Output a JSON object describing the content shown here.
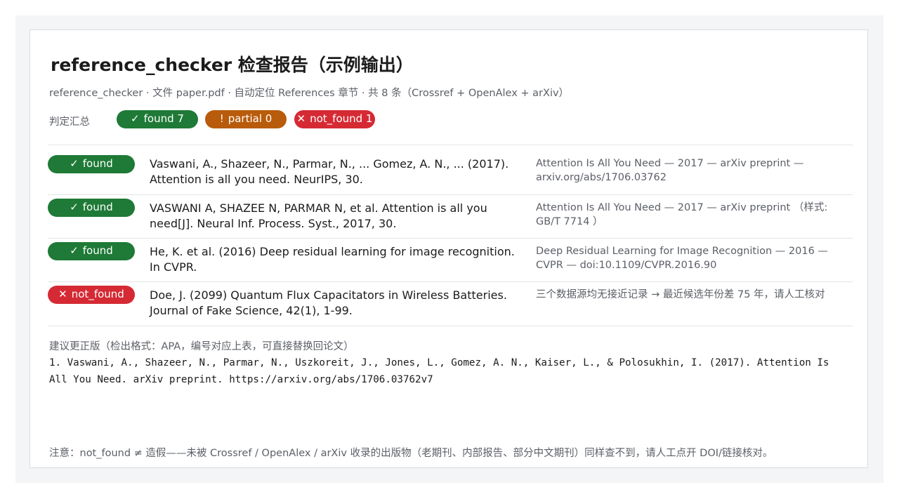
{
  "report": {
    "title": "reference_checker 检查报告（示例输出）",
    "subtitle": "reference_checker · 文件 paper.pdf · 自动定位 References 章节 · 共 8 条（Crossref + OpenAlex + arXiv）",
    "summary_label": "判定汇总"
  },
  "summary": {
    "found": {
      "icon": "✓",
      "text": "found 7",
      "color": "#1e7a36"
    },
    "partial": {
      "icon": "!",
      "text": "partial 0",
      "color": "#b85b0a"
    },
    "not_found": {
      "icon": "✕",
      "text": "not_found 1",
      "color": "#d52a34"
    }
  },
  "rows": [
    {
      "status_icon": "✓",
      "status": "found",
      "reference": "Vaswani, A., Shazeer, N., Parmar, N., ... Gomez, A. N., ... (2017). Attention is all you need. NeurIPS, 30.",
      "match": "Attention Is All You Need — 2017 — arXiv preprint — arxiv.org/abs/1706.03762"
    },
    {
      "status_icon": "✓",
      "status": "found",
      "reference": "VASWANI A, SHAZEE N, PARMAR N, et al. Attention is all you need[J]. Neural Inf. Process. Syst., 2017, 30.",
      "match": "Attention Is All You Need — 2017 — arXiv preprint （样式: GB/T 7714 ）"
    },
    {
      "status_icon": "✓",
      "status": "found",
      "reference": "He, K. et al. (2016) Deep residual learning for image recognition. In CVPR.",
      "match": "Deep Residual Learning for Image Recognition — 2016 — CVPR — doi:10.1109/CVPR.2016.90"
    },
    {
      "status_icon": "✕",
      "status": "not_found",
      "reference": "Doe, J. (2099) Quantum Flux Capacitators in Wireless Batteries. Journal of Fake Science, 42(1), 1-99.",
      "match": "三个数据源均无接近记录 → 最近候选年份差 75 年，请人工核对"
    }
  ],
  "suggestion": {
    "label": "建议更正版（检出格式：APA，编号对应上表，可直接替换回论文）",
    "text": "1. Vaswani, A., Shazeer, N., Parmar, N., Uszkoreit, J., Jones, L., Gomez, A. N., Kaiser, L., & Polosukhin, I. (2017). Attention Is All You Need. arXiv preprint. https://arxiv.org/abs/1706.03762v7"
  },
  "note": "注意：not_found ≠ 造假——未被 Crossref / OpenAlex / arXiv 收录的出版物（老期刊、内部报告、部分中文期刊）同样查不到，请人工点开 DOI/链接核对。"
}
